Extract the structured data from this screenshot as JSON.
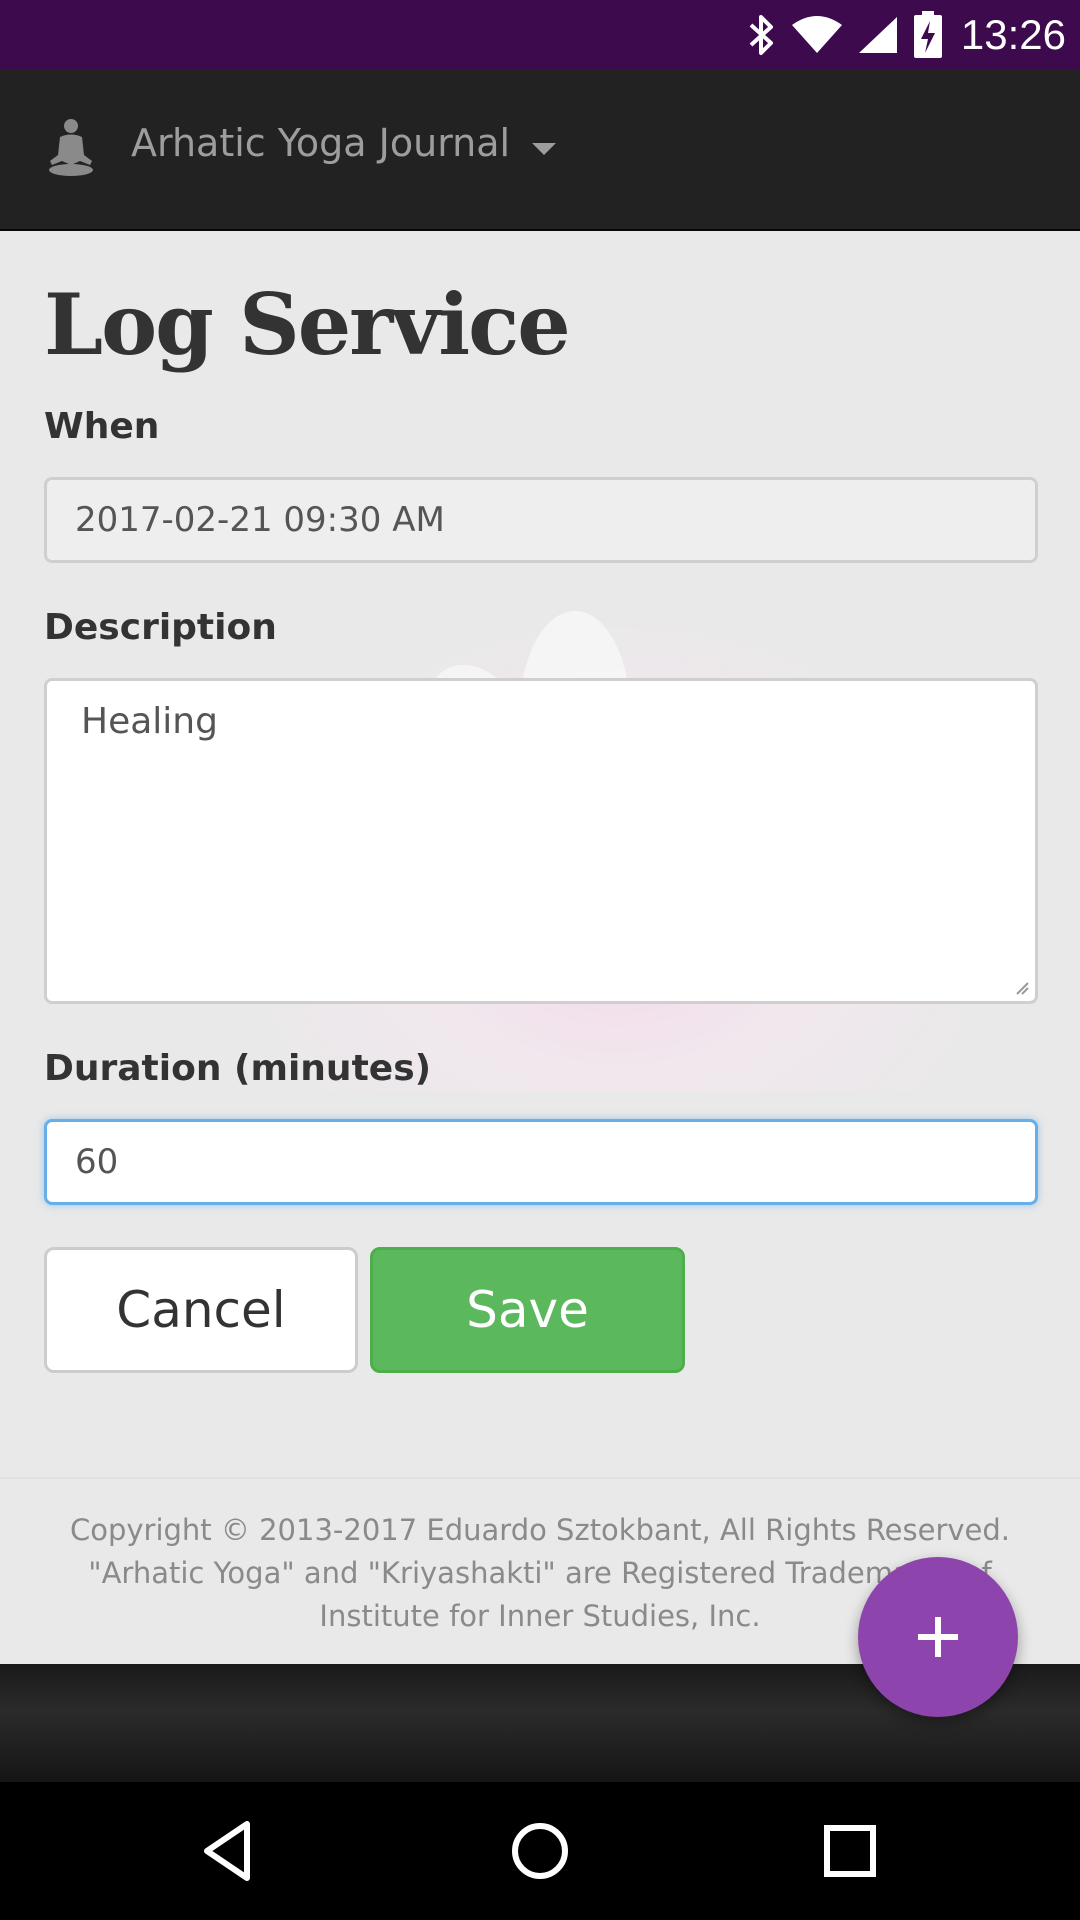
{
  "status_bar": {
    "time": "13:26",
    "icons": [
      "bluetooth-icon",
      "wifi-icon",
      "signal-icon",
      "battery-charging-icon"
    ]
  },
  "app_bar": {
    "title": "Arhatic Yoga Journal",
    "logo_icon": "meditating-figure-icon",
    "menu_icon": "caret-down-icon"
  },
  "page": {
    "title": "Log Service",
    "when": {
      "label": "When",
      "value": "2017-02-21 09:30 AM"
    },
    "description": {
      "label": "Description",
      "value": "Healing"
    },
    "duration": {
      "label": "Duration (minutes)",
      "value": "60"
    },
    "cancel_label": "Cancel",
    "save_label": "Save"
  },
  "footer": {
    "line1": "Copyright © 2013-2017 Eduardo Sztokbant, All Rights Reserved.",
    "line2": "\"Arhatic Yoga\" and \"Kriyashakti\" are Registered Trademarks of",
    "line3": "Institute for Inner Studies, Inc."
  },
  "fab": {
    "icon": "plus-icon"
  },
  "nav_bar": {
    "icons": [
      "back-icon",
      "home-icon",
      "recents-icon"
    ]
  },
  "colors": {
    "status_bar": "#3d0a4d",
    "app_bar": "#222222",
    "save_button": "#5cb85c",
    "fab": "#8e44ad",
    "focus_border": "#66afe9"
  }
}
